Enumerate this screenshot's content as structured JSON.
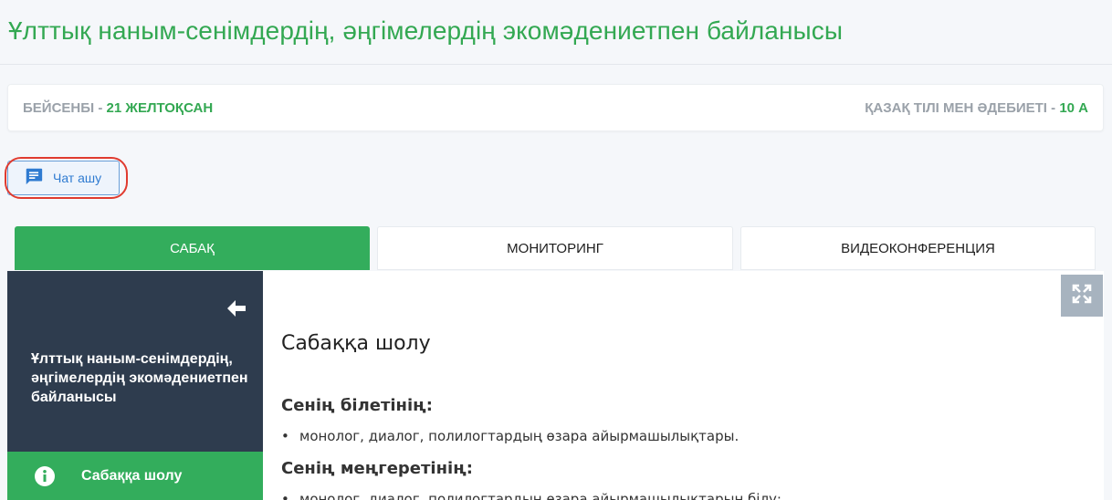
{
  "page": {
    "title": "Ұлттық наным-сенімдердің, әңгімелердің экомәдениетпен байланысы"
  },
  "info_bar": {
    "day_label": "БЕЙСЕНБІ - ",
    "date": "21 ЖЕЛТОҚСАН",
    "subject_label": "ҚАЗАҚ ТІЛІ МЕН ӘДЕБИЕТІ - ",
    "class": "10 А"
  },
  "chat_button": {
    "label": "Чат ашу",
    "icon": "chat-icon"
  },
  "tabs": [
    {
      "label": "САБАҚ",
      "active": true
    },
    {
      "label": "МОНИТОРИНГ",
      "active": false
    },
    {
      "label": "ВИДЕОКОНФЕРЕНЦИЯ",
      "active": false
    }
  ],
  "sidebar": {
    "back_icon": "arrow-left-icon",
    "lesson_title": "Ұлттық наным-сенімдердің, әңгімелердің экомәдениетпен байланысы",
    "items": [
      {
        "label": "Сабаққа шолу",
        "icon": "info-icon"
      }
    ]
  },
  "content": {
    "expand_icon": "expand-icon",
    "heading": "Сабаққа шолу",
    "sections": [
      {
        "title": "Сенің білетінің:",
        "bullets": [
          "монолог, диалог, полилогтардың өзара айырмашылықтары."
        ]
      },
      {
        "title": "Сенің меңгеретінің:",
        "bullets": [
          "монолог, диалог, полилогтардың өзара айырмашылықтарын білу;"
        ]
      }
    ]
  },
  "colors": {
    "accent_green": "#33a852",
    "sidebar_bg": "#2e3c4e",
    "chat_blue": "#2f7bd1",
    "highlight_red": "#e03b2f"
  }
}
